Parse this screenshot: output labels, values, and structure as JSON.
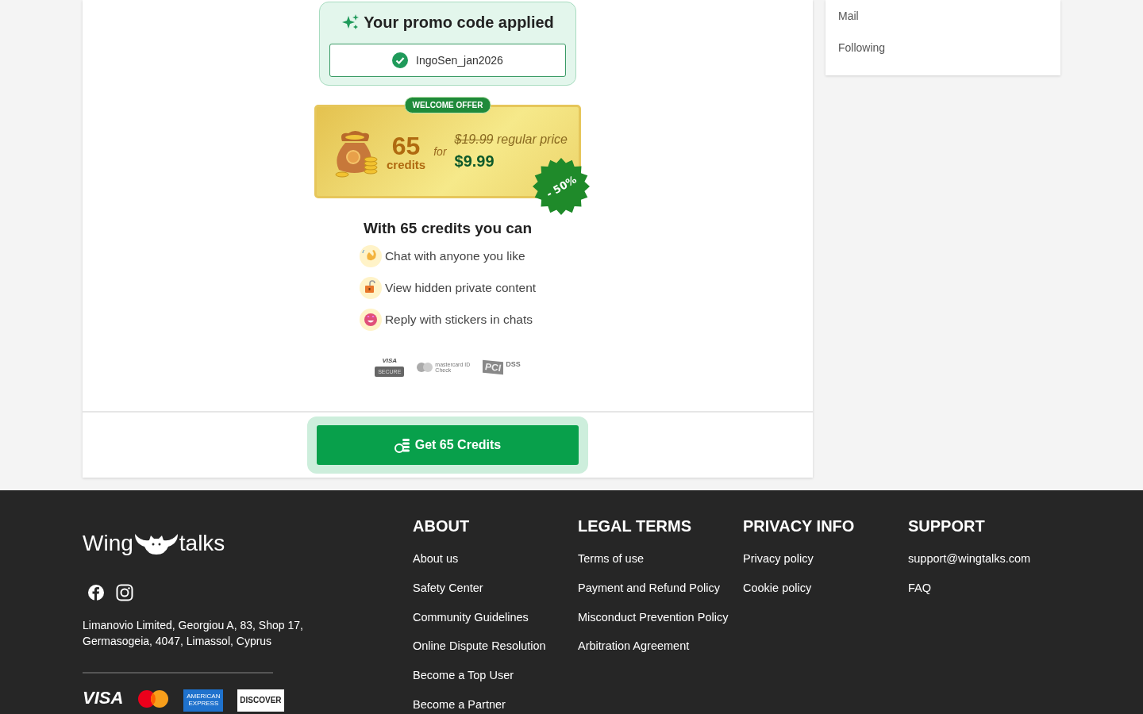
{
  "promo": {
    "title": "Your promo code applied",
    "code": "IngoSen_jan2026",
    "applied": true
  },
  "offer": {
    "badge": "WELCOME OFFER",
    "amount": "65",
    "unit": "credits",
    "joiner": "for",
    "old_price": "$19.99",
    "old_label": "regular price",
    "price": "$9.99",
    "discount": "- 50%"
  },
  "benefits_title": "With 65 credits you can",
  "benefits": [
    {
      "kind": "wave",
      "text": "Chat with anyone you like"
    },
    {
      "kind": "lock",
      "text": "View hidden private content"
    },
    {
      "kind": "smile",
      "text": "Reply with stickers in chats"
    }
  ],
  "trust": [
    {
      "kind": "visa",
      "texts": [
        "VISA",
        "SECURE"
      ]
    },
    {
      "kind": "mastercard",
      "texts": [
        "mastercard",
        "ID Check"
      ]
    },
    {
      "kind": "pci",
      "texts": [
        "PCI",
        "DSS"
      ]
    }
  ],
  "cta": "Get 65 Credits",
  "sidebar": [
    {
      "label": "Mail"
    },
    {
      "label": "Following"
    }
  ],
  "footer": {
    "logo": [
      "Wing",
      "talks"
    ],
    "address": "Limanovio Limited, Georgiou A, 83, Shop 17, Germasogeia, 4047, Limassol, Cyprus",
    "columns": [
      {
        "title": "ABOUT",
        "links": [
          "About us",
          "Safety Center",
          "Community Guidelines",
          "Online Dispute Resolution",
          "Become a Top User",
          "Become a Partner"
        ]
      },
      {
        "title": "LEGAL TERMS",
        "links": [
          "Terms of use",
          "Payment and Refund Policy",
          "Misconduct Prevention Policy",
          "Arbitration Agreement"
        ]
      },
      {
        "title": "PRIVACY INFO",
        "links": [
          "Privacy policy",
          "Cookie policy"
        ]
      },
      {
        "title": "SUPPORT",
        "links": [
          "support@wingtalks.com",
          "FAQ"
        ]
      }
    ],
    "cards": [
      {
        "kind": "visa",
        "text": "VISA"
      },
      {
        "kind": "mastercard"
      },
      {
        "kind": "amex",
        "text": "AMERICAN EXPRESS"
      },
      {
        "kind": "discover",
        "text": "DISCOVER"
      }
    ]
  }
}
